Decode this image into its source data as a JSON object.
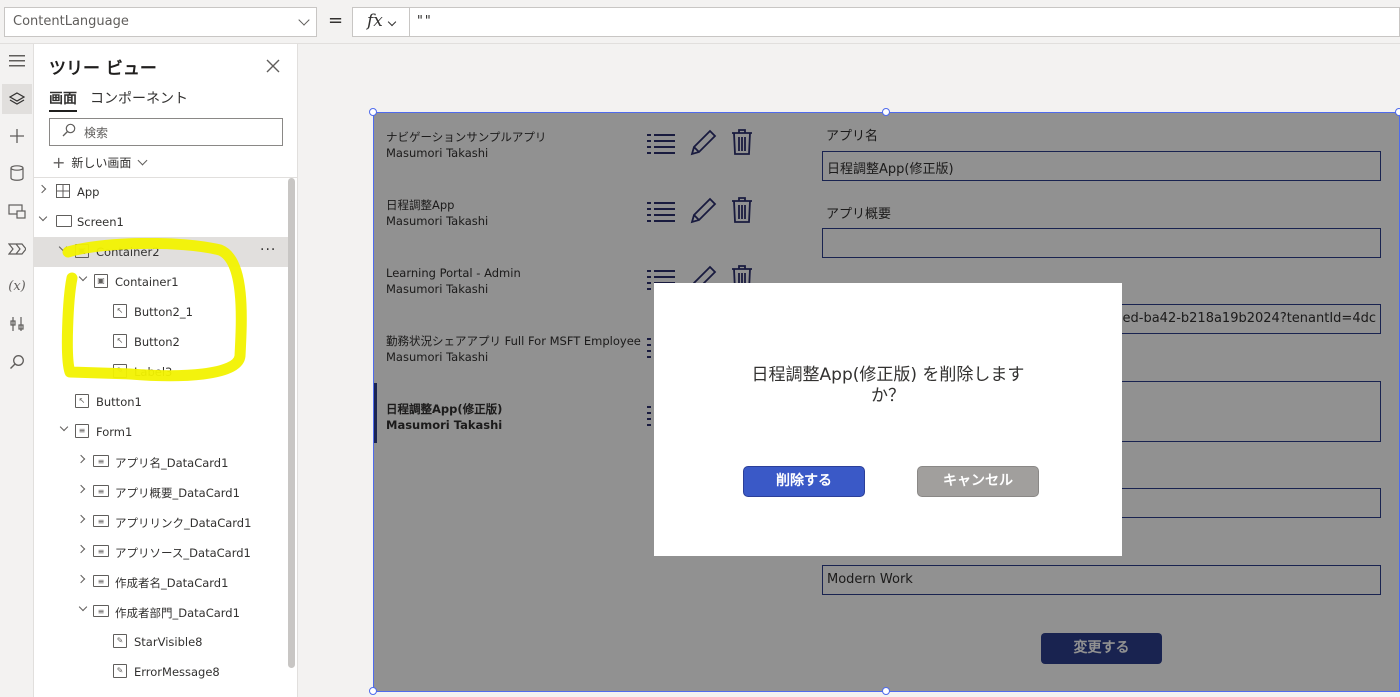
{
  "formula_bar": {
    "property": "ContentLanguage",
    "equals": "=",
    "fx": "fx",
    "formula": "\"\""
  },
  "tree_view": {
    "title": "ツリー ビュー",
    "tabs": {
      "screen": "画面",
      "component": "コンポーネント"
    },
    "search_placeholder": "検索",
    "new_screen": "新しい画面",
    "items": [
      {
        "label": "App"
      },
      {
        "label": "Screen1"
      },
      {
        "label": "Container2"
      },
      {
        "label": "Container1"
      },
      {
        "label": "Button2_1"
      },
      {
        "label": "Button2"
      },
      {
        "label": "Label3"
      },
      {
        "label": "Button1"
      },
      {
        "label": "Form1"
      },
      {
        "label": "アプリ名_DataCard1"
      },
      {
        "label": "アプリ概要_DataCard1"
      },
      {
        "label": "アプリリンク_DataCard1"
      },
      {
        "label": "アプリソース_DataCard1"
      },
      {
        "label": "作成者名_DataCard1"
      },
      {
        "label": "作成者部門_DataCard1"
      },
      {
        "label": "StarVisible8"
      },
      {
        "label": "ErrorMessage8"
      }
    ],
    "more_label": "···"
  },
  "gallery": {
    "items": [
      {
        "title": "ナビゲーションサンプルアプリ",
        "author": "Masumori Takashi"
      },
      {
        "title": "日程調整App",
        "author": "Masumori Takashi"
      },
      {
        "title": "Learning Portal - Admin",
        "author": "Masumori Takashi"
      },
      {
        "title": "勤務状況シェアアプリ Full For MSFT Employee",
        "author": "Masumori Takashi"
      },
      {
        "title": "日程調整App(修正版)",
        "author": "Masumori Takashi"
      }
    ]
  },
  "form": {
    "label_app_name": "アプリ名",
    "value_app_name": "日程調整App(修正版)",
    "label_app_summary": "アプリ概要",
    "value_app_summary": "",
    "value_link": "a-43ed-ba42-b218a19b2024?tenantId=4dc",
    "value_department": "Modern Work",
    "change_button": "変更する"
  },
  "dialog": {
    "message_line1": "日程調整App(修正版) を削除します",
    "message_line2": "か？",
    "delete_button": "削除する",
    "cancel_button": "キャンセル"
  },
  "colors": {
    "accent": "#2d3f8e",
    "highlight": "#f2f200",
    "selection": "#4f6bed"
  }
}
